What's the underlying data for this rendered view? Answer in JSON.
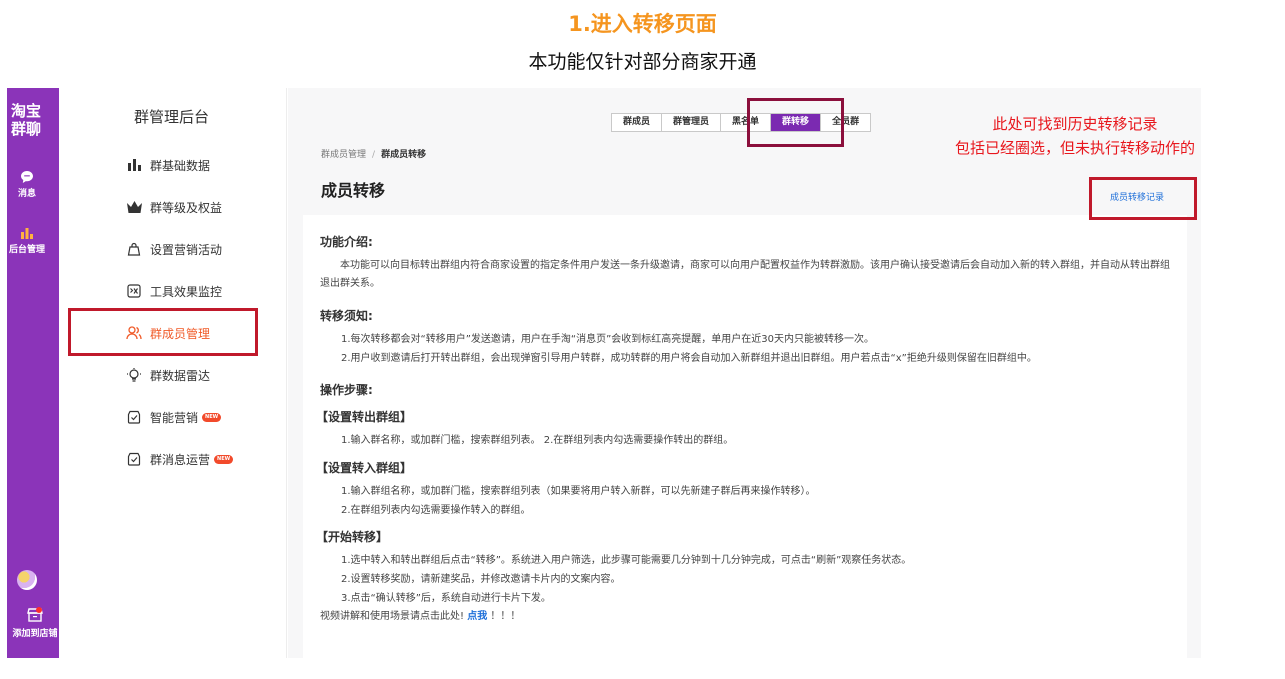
{
  "header": {
    "title": "1.进入转移页面",
    "subtitle": "本功能仅针对部分商家开通"
  },
  "rail": {
    "brand": "淘宝\n群聊",
    "items": [
      {
        "label": "消息",
        "icon": "chat-bubble-icon"
      },
      {
        "label": "后台管理",
        "icon": "bar-chart-icon"
      }
    ],
    "store_label": "添加到店铺",
    "accent": "#8b34b9"
  },
  "subnav": {
    "title": "群管理后台",
    "items": [
      {
        "label": "群基础数据",
        "icon": "bar-chart-icon"
      },
      {
        "label": "群等级及权益",
        "icon": "crown-icon"
      },
      {
        "label": "设置营销活动",
        "icon": "bag-icon"
      },
      {
        "label": "工具效果监控",
        "icon": "monitor-icon"
      },
      {
        "label": "群成员管理",
        "icon": "users-icon",
        "active": true
      },
      {
        "label": "群数据雷达",
        "icon": "bulb-icon"
      },
      {
        "label": "智能营销",
        "icon": "shield-check-icon",
        "badge": "NEW"
      },
      {
        "label": "群消息运营",
        "icon": "shield-check-icon",
        "badge": "NEW"
      }
    ]
  },
  "tabs": [
    "群成员",
    "群管理员",
    "黑名单",
    "群转移",
    "全员群"
  ],
  "active_tab": "群转移",
  "breadcrumb": {
    "parent": "群成员管理",
    "sep": "/",
    "current": "群成员转移"
  },
  "page_title": "成员转移",
  "record_link": "成员转移记录",
  "annotation": {
    "line1": "此处可找到历史转移记录",
    "line2": "包括已经圈选，但未执行转移动作的",
    "color": "#e8171d"
  },
  "content": {
    "intro_heading": "功能介绍:",
    "intro_text": "本功能可以向目标转出群组内符合商家设置的指定条件用户发送一条升级邀请，商家可以向用户配置权益作为转群激励。该用户确认接受邀请后会自动加入新的转入群组，并自动从转出群组退出群关系。",
    "notice_heading": "转移须知:",
    "notice_1": "1.每次转移都会对“转移用户”发送邀请，用户在手淘“消息页”会收到标红高亮提醒，单用户在近30天内只能被转移一次。",
    "notice_2": "2.用户收到邀请后打开转出群组，会出现弹窗引导用户转群，成功转群的用户将会自动加入新群组并退出旧群组。用户若点击“x”拒绝升级则保留在旧群组中。",
    "steps_heading": "操作步骤:",
    "step1_title": "【设置转出群组】",
    "step1_text": "1.输入群名称，或加群门槛，搜索群组列表。 2.在群组列表内勾选需要操作转出的群组。",
    "step2_title": "【设置转入群组】",
    "step2_text_1": "1.输入群组名称，或加群门槛，搜索群组列表（如果要将用户转入新群，可以先新建子群后再来操作转移）。",
    "step2_text_2": "2.在群组列表内勾选需要操作转入的群组。",
    "step3_title": "【开始转移】",
    "step3_text_1": "1.选中转入和转出群组后点击“转移”。系统进入用户筛选，此步骤可能需要几分钟到十几分钟完成，可点击“刷新”观察任务状态。",
    "step3_text_2": "2.设置转移奖励，请新建奖品，并修改邀请卡片内的文案内容。",
    "step3_text_3": "3.点击“确认转移”后，系统自动进行卡片下发。",
    "video_text": "视频讲解和使用场景请点击此处!",
    "video_link": "点我",
    "video_suffix": "！！！"
  }
}
